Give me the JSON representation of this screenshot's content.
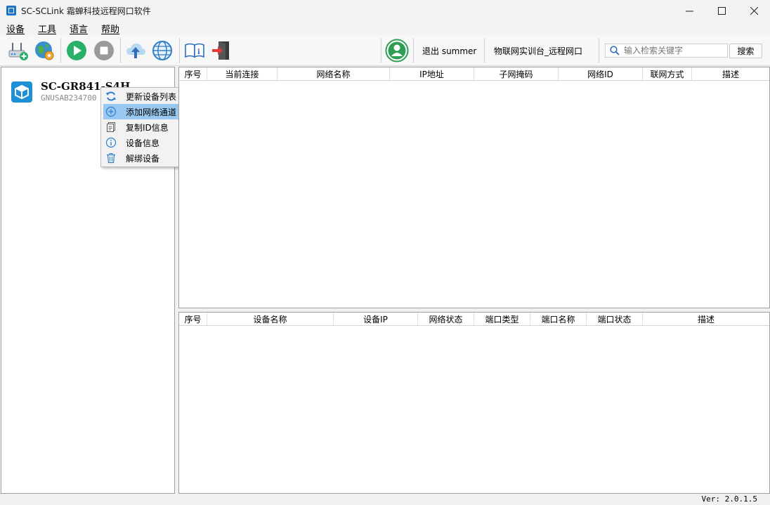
{
  "window": {
    "title": "SC-SCLink 霜蝉科技远程网口软件",
    "minimize": "—",
    "maximize": "☐",
    "close": "✕"
  },
  "menu": [
    "设备",
    "工具",
    "语言",
    "帮助"
  ],
  "toolbar": {
    "logout_text": "退出 summer",
    "project_text": "物联网实训台_远程网口",
    "search_placeholder": "输入检索关键字",
    "search_button": "搜索"
  },
  "device": {
    "name": "SC-GR841-S4H",
    "id": "GNUSAB234700"
  },
  "context_menu": {
    "items": [
      "更新设备列表",
      "添加网络通道",
      "复制ID信息",
      "设备信息",
      "解绑设备"
    ],
    "highlighted_index": 1
  },
  "top_table": {
    "columns": [
      "序号",
      "当前连接",
      "网络名称",
      "IP地址",
      "子网掩码",
      "网络ID",
      "联网方式",
      "描述"
    ]
  },
  "bottom_table": {
    "columns": [
      "序号",
      "设备名称",
      "设备IP",
      "网络状态",
      "端口类型",
      "端口名称",
      "端口状态",
      "描述"
    ]
  },
  "status": {
    "version": "Ver: 2.0.1.5"
  },
  "colors": {
    "accent": "#1f8fd6",
    "highlight": "#99c9f0",
    "play_green": "#2ab06a",
    "avatar_green": "#2e9e55"
  }
}
